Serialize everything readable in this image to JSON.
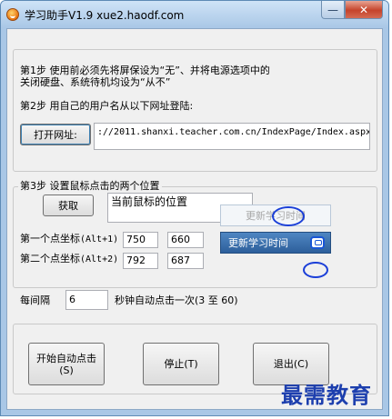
{
  "window": {
    "title": "学习助手V1.9 xue2.haodf.com",
    "minimize_glyph": "—",
    "close_glyph": "✕"
  },
  "step1": {
    "line1": "第1步  使用前必须先将屏保设为“无”、并将电源选项中的",
    "line2": "关闭硬盘、系统待机均设为“从不”"
  },
  "step2": {
    "label": "第2步  用自己的用户名从以下网址登陆:",
    "open_button": "打开网址:",
    "url_value": "://2011.shanxi.teacher.com.cn/IndexPage/Index.aspx"
  },
  "step3": {
    "group_title": "第3步  设置鼠标点击的两个位置",
    "get_button": "获取",
    "position_display": "当前鼠标的位置",
    "point1": {
      "label": "第一个点坐标",
      "hotkey": "(Alt+1)",
      "x": "750",
      "y": "660"
    },
    "point2": {
      "label": "第二个点坐标",
      "hotkey": "(Alt+2)",
      "x": "792",
      "y": "687"
    },
    "update_disabled": "更新学习时间",
    "update_active": "更新学习时间"
  },
  "interval": {
    "prefix": "每间隔",
    "value": "6",
    "suffix": "秒钟自动点击一次(3 至 60)"
  },
  "actions": {
    "start_line1": "开始自动点击",
    "start_line2": "(S)",
    "stop": "停止(T)",
    "exit": "退出(C)"
  },
  "watermark": "最需教育",
  "colors": {
    "title_bar": "#a9c7e6",
    "close_button": "#c5432b",
    "update_active_bg": "#2d5f9b",
    "annotation_ring": "#1b3fd8",
    "watermark": "#1d3fae"
  },
  "icons": {
    "app": "app-logo-icon",
    "update": "refresh-window-icon"
  }
}
